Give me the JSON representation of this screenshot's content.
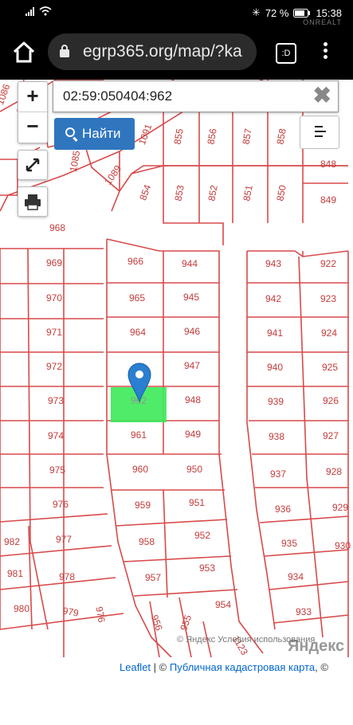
{
  "status_bar": {
    "bluetooth": "✳",
    "battery_text": "72 %",
    "time": "15:38",
    "watermark": "ONREALT"
  },
  "browser": {
    "url": "egrp365.org/map/?ka",
    "tabs_label": ":D"
  },
  "map": {
    "search_value": "02:59:050404:962",
    "search_button": "Найти",
    "zoom_in": "+",
    "zoom_out": "−",
    "clear": "✖",
    "parcels": [
      {
        "label": "1086"
      },
      {
        "label": "1091"
      },
      {
        "label": "855"
      },
      {
        "label": "856"
      },
      {
        "label": "857"
      },
      {
        "label": "858"
      },
      {
        "label": "847"
      },
      {
        "label": "1085"
      },
      {
        "label": "1089"
      },
      {
        "label": "854"
      },
      {
        "label": "853"
      },
      {
        "label": "852"
      },
      {
        "label": "851"
      },
      {
        "label": "850"
      },
      {
        "label": "848"
      },
      {
        "label": "849"
      },
      {
        "label": "968"
      },
      {
        "label": "969"
      },
      {
        "label": "966"
      },
      {
        "label": "944"
      },
      {
        "label": "943"
      },
      {
        "label": "922"
      },
      {
        "label": "970"
      },
      {
        "label": "965"
      },
      {
        "label": "945"
      },
      {
        "label": "942"
      },
      {
        "label": "923"
      },
      {
        "label": "971"
      },
      {
        "label": "964"
      },
      {
        "label": "946"
      },
      {
        "label": "941"
      },
      {
        "label": "924"
      },
      {
        "label": "972"
      },
      {
        "label": "947"
      },
      {
        "label": "940"
      },
      {
        "label": "925"
      },
      {
        "label": "973"
      },
      {
        "label": "962"
      },
      {
        "label": "948"
      },
      {
        "label": "939"
      },
      {
        "label": "926"
      },
      {
        "label": "974"
      },
      {
        "label": "961"
      },
      {
        "label": "949"
      },
      {
        "label": "938"
      },
      {
        "label": "927"
      },
      {
        "label": "975"
      },
      {
        "label": "960"
      },
      {
        "label": "950"
      },
      {
        "label": "937"
      },
      {
        "label": "928"
      },
      {
        "label": "976"
      },
      {
        "label": "959"
      },
      {
        "label": "951"
      },
      {
        "label": "936"
      },
      {
        "label": "929"
      },
      {
        "label": "982"
      },
      {
        "label": "977"
      },
      {
        "label": "958"
      },
      {
        "label": "952"
      },
      {
        "label": "935"
      },
      {
        "label": "930"
      },
      {
        "label": "981"
      },
      {
        "label": "978"
      },
      {
        "label": "957"
      },
      {
        "label": "953"
      },
      {
        "label": "934"
      },
      {
        "label": "980"
      },
      {
        "label": "979"
      },
      {
        "label": "976"
      },
      {
        "label": "956"
      },
      {
        "label": "955"
      },
      {
        "label": "954"
      },
      {
        "label": "933"
      },
      {
        "label": "1123"
      }
    ],
    "highlight_parcel": "962",
    "highlight_color": "#3cea5a",
    "parcel_line_color": "#d84a4a",
    "marker_color": "#2a7fd0",
    "yandex_logo": "Яндекс",
    "yandex_terms": "© Яндекс Условия использования",
    "attribution_leaflet": "Leaflet",
    "attribution_sep": "| ©",
    "attribution_kadastr": "Публичная кадастровая карта",
    "attribution_tail": ", ©"
  }
}
